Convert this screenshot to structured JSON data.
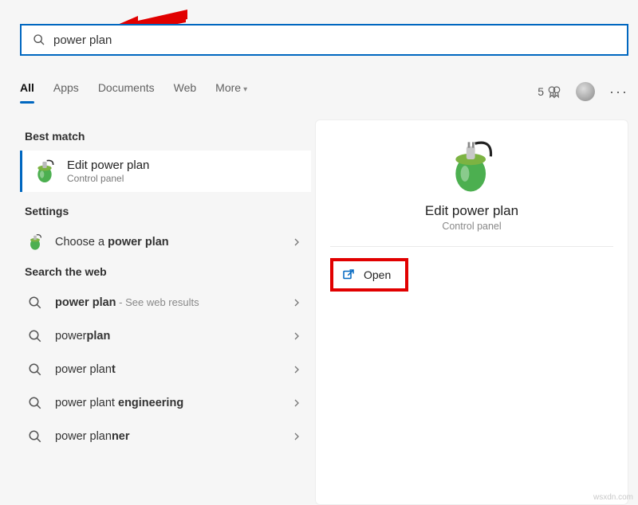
{
  "search": {
    "value": "power plan"
  },
  "filters": {
    "all": "All",
    "apps": "Apps",
    "documents": "Documents",
    "web": "Web",
    "more": "More"
  },
  "rewards": {
    "points": "5"
  },
  "sections": {
    "best_match": "Best match",
    "settings": "Settings",
    "web": "Search the web"
  },
  "best_match_item": {
    "title": "Edit power plan",
    "subtitle": "Control panel"
  },
  "settings_items": [
    {
      "pre": "Choose a ",
      "bold": "power plan",
      "post": ""
    }
  ],
  "web_items": [
    {
      "pre": "",
      "bold": "power plan",
      "post": "",
      "suffix": " - See web results"
    },
    {
      "pre": "power",
      "bold": "plan",
      "post": ""
    },
    {
      "pre": "power plan",
      "bold": "t",
      "post": ""
    },
    {
      "pre": "power plant ",
      "bold": "engineering",
      "post": ""
    },
    {
      "pre": "power plan",
      "bold": "ner",
      "post": ""
    }
  ],
  "preview": {
    "title": "Edit power plan",
    "subtitle": "Control panel",
    "open": "Open"
  },
  "watermark": "wsxdn.com"
}
